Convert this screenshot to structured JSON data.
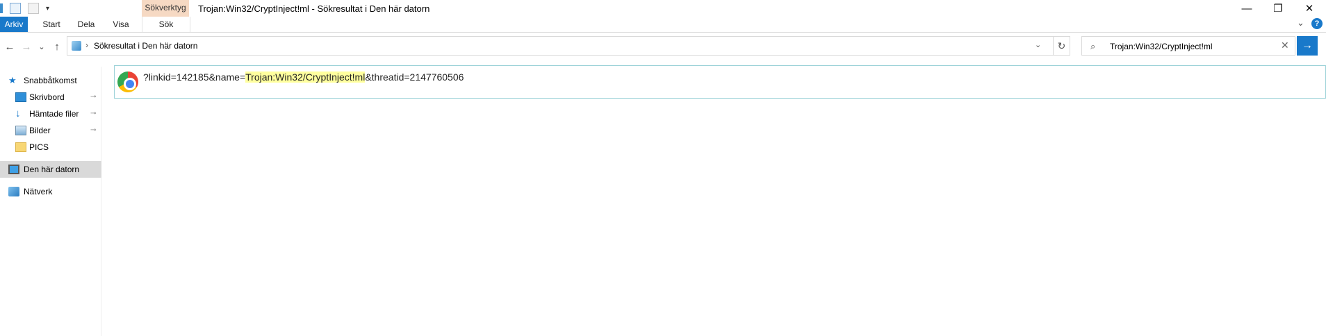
{
  "window": {
    "title": "Trojan:Win32/CryptInject!ml - Sökresultat i Den här datorn",
    "context_tab_group": "Sökverktyg",
    "controls": {
      "minimize": "—",
      "restore": "❐",
      "close": "✕"
    }
  },
  "ribbon": {
    "tabs": [
      "Arkiv",
      "Start",
      "Dela",
      "Visa",
      "Sök"
    ],
    "expand_icon": "⌄",
    "help_icon": "?"
  },
  "nav": {
    "back": "←",
    "forward": "→",
    "recent": "⌄",
    "up": "↑",
    "address_sep": "›",
    "address_text": "Sökresultat i Den här datorn",
    "address_dropdown": "⌄",
    "refresh": "↻"
  },
  "search": {
    "value": "Trojan:Win32/CryptInject!ml",
    "clear": "✕",
    "go": "→"
  },
  "sidebar": {
    "items": [
      {
        "label": "Snabbåtkomst",
        "icon": "star-icon",
        "pinned": false
      },
      {
        "label": "Skrivbord",
        "icon": "desktop-icon",
        "pinned": true
      },
      {
        "label": "Hämtade filer",
        "icon": "download-icon",
        "pinned": true
      },
      {
        "label": "Bilder",
        "icon": "pictures-icon",
        "pinned": true
      },
      {
        "label": "PICS",
        "icon": "folder-icon",
        "pinned": false
      },
      {
        "label": "Den här datorn",
        "icon": "computer-icon",
        "pinned": false,
        "selected": true
      },
      {
        "label": "Nätverk",
        "icon": "network-icon",
        "pinned": false
      }
    ],
    "pin_glyph": "📌"
  },
  "result": {
    "prefix": "?linkid=142185&name=",
    "highlight": "Trojan:Win32/CryptInject!ml",
    "suffix": "&threatid=2147760506"
  },
  "colors": {
    "accent": "#1979ca",
    "context_tab": "#f6d9c3",
    "highlight": "#ffff9e",
    "result_border": "#99d1d7",
    "selected": "#d9d9d9"
  }
}
